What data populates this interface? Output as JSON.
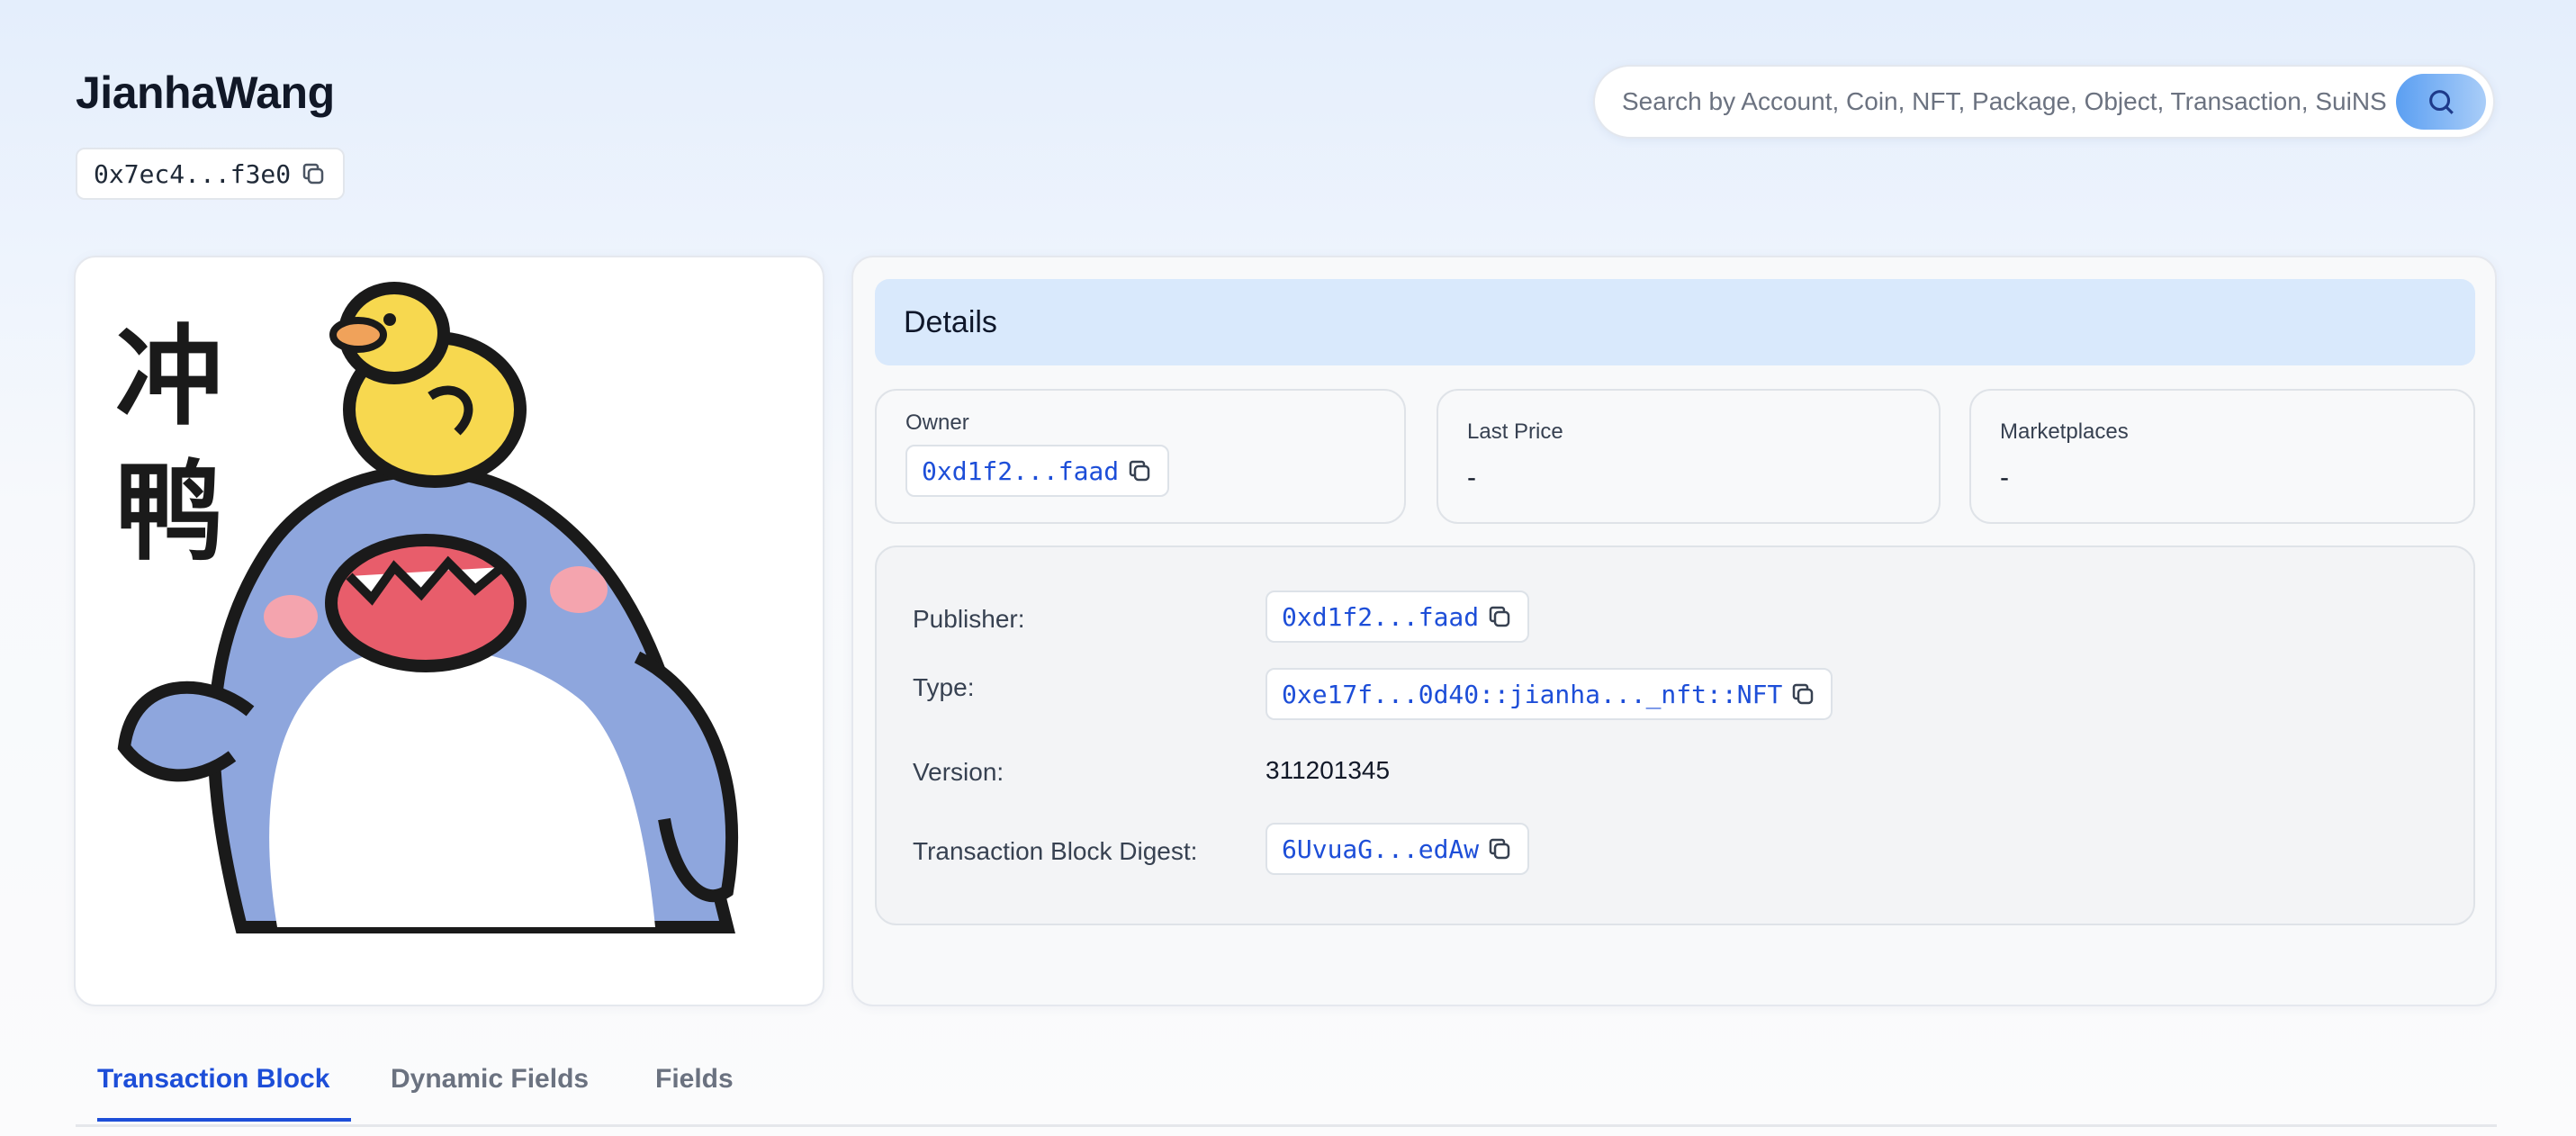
{
  "header": {
    "title": "JianhaWang",
    "address": "0x7ec4...f3e0"
  },
  "search": {
    "placeholder": "Search by Account, Coin, NFT, Package, Object, Transaction, SuiNS"
  },
  "details": {
    "title": "Details",
    "owner_label": "Owner",
    "owner_value": "0xd1f2...faad",
    "last_price_label": "Last Price",
    "last_price_value": "-",
    "marketplaces_label": "Marketplaces",
    "marketplaces_value": "-",
    "properties": {
      "publisher_label": "Publisher:",
      "publisher_value": "0xd1f2...faad",
      "type_label": "Type:",
      "type_value": "0xe17f...0d40::jianha..._nft::NFT",
      "version_label": "Version:",
      "version_value": "311201345",
      "digest_label": "Transaction Block Digest:",
      "digest_value": "6UvuaG...edAw"
    }
  },
  "image": {
    "caption_chars": "冲鸭"
  },
  "tabs": [
    {
      "label": "Transaction Block",
      "active": true
    },
    {
      "label": "Dynamic Fields",
      "active": false
    },
    {
      "label": "Fields",
      "active": false
    }
  ],
  "colors": {
    "accent": "#1d4ed8",
    "details_header_bg": "#d9e9fc",
    "search_button": "#5b9ff2"
  }
}
